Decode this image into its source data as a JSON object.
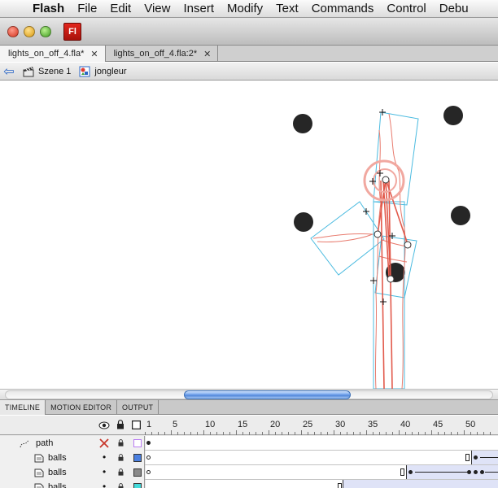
{
  "menubar": {
    "apple_glyph": "",
    "items": [
      "Flash",
      "File",
      "Edit",
      "View",
      "Insert",
      "Modify",
      "Text",
      "Commands",
      "Control",
      "Debu"
    ]
  },
  "window": {
    "app_icon_label": "Fl"
  },
  "document_tabs": [
    {
      "label": "lights_on_off_4.fla*",
      "close": "✕",
      "active": true
    },
    {
      "label": "lights_on_off_4.fla:2*",
      "close": "✕",
      "active": false
    }
  ],
  "editbar": {
    "back_glyph": "⇦",
    "scene_label": "Szene 1",
    "symbol_label": "jongleur"
  },
  "stage": {
    "background": "#ffffff",
    "ball_color": "#262626",
    "bone_color": "#e87b6e",
    "box_color": "#4bbbe0"
  },
  "scrollbar": {
    "thumb_color": "#5a8ee0"
  },
  "panel_tabs": [
    "TIMELINE",
    "MOTION EDITOR",
    "OUTPUT"
  ],
  "timeline": {
    "ruler": [
      "1",
      "5",
      "10",
      "15",
      "20",
      "25",
      "30",
      "35",
      "40",
      "45",
      "50",
      "5"
    ],
    "header_icons": {
      "eye": "eye-icon",
      "lock": "lock-icon",
      "outline": "outline-icon"
    },
    "layers": [
      {
        "name": "path",
        "type": "motion-guide",
        "color": "#b97cf2"
      },
      {
        "name": "balls",
        "type": "layer",
        "color": "#4a7fe0"
      },
      {
        "name": "balls",
        "type": "layer",
        "color": "#8a8a8a"
      },
      {
        "name": "balls",
        "type": "layer",
        "color": "#44dada"
      }
    ]
  }
}
